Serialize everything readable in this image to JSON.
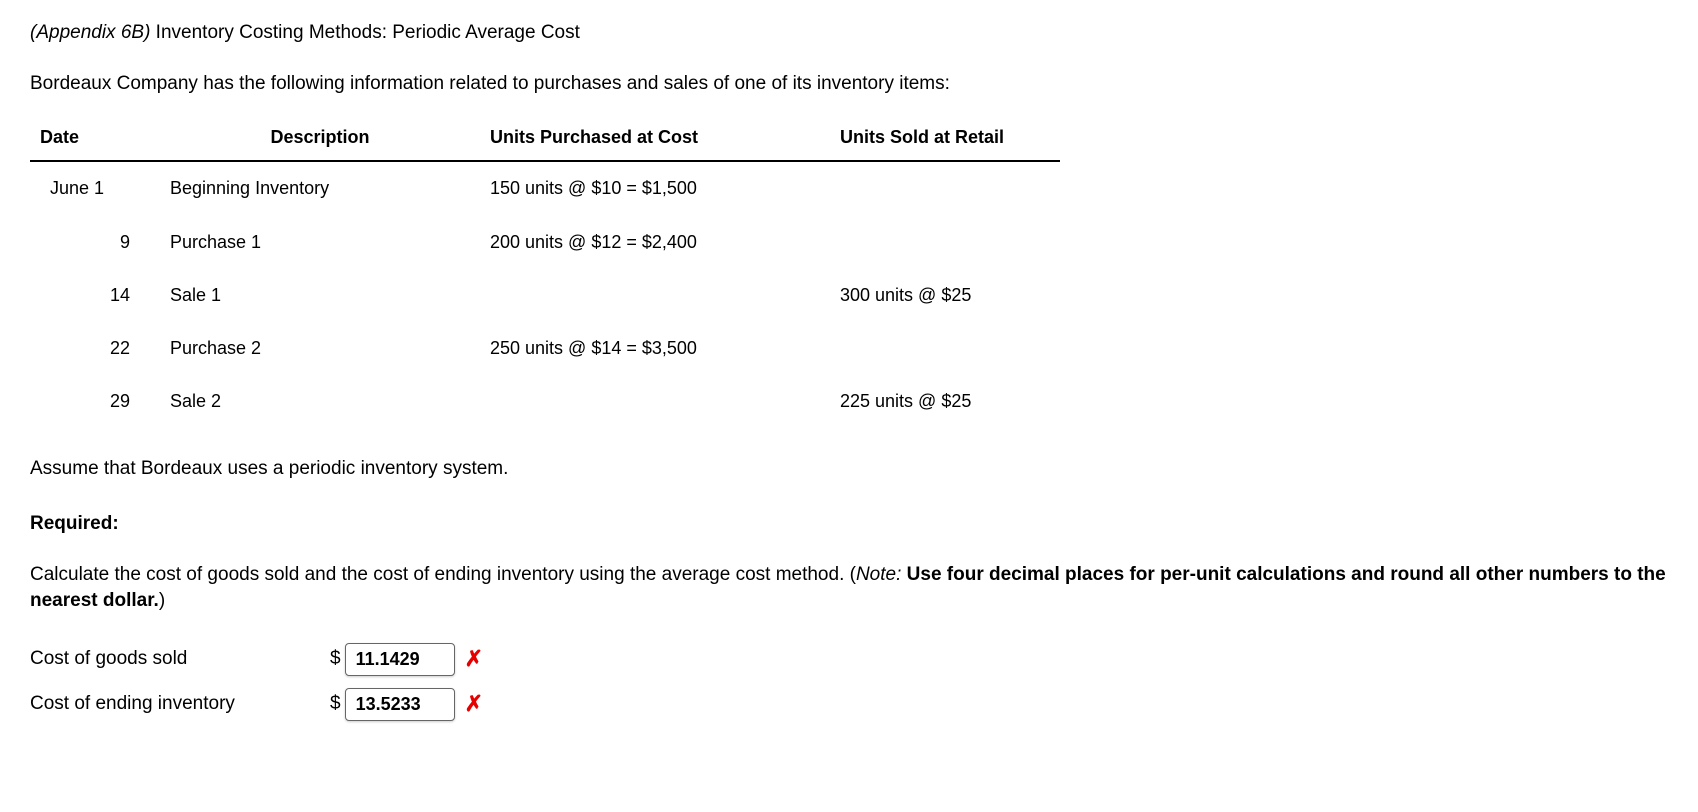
{
  "title_italic": "(Appendix 6B)",
  "title_rest": " Inventory Costing Methods: Periodic Average Cost",
  "intro": "Bordeaux Company has the following information related to purchases and sales of one of its inventory items:",
  "table": {
    "headers": {
      "date": "Date",
      "description": "Description",
      "purchased": "Units Purchased at Cost",
      "sold": "Units Sold at Retail"
    },
    "rows": [
      {
        "date": "June 1",
        "desc": "Beginning Inventory",
        "purchased": "150 units @ $10 = $1,500",
        "sold": ""
      },
      {
        "date": "9",
        "desc": "Purchase 1",
        "purchased": "200 units @ $12 = $2,400",
        "sold": ""
      },
      {
        "date": "14",
        "desc": "Sale 1",
        "purchased": "",
        "sold": "300 units @ $25"
      },
      {
        "date": "22",
        "desc": "Purchase 2",
        "purchased": "250 units @ $14 = $3,500",
        "sold": ""
      },
      {
        "date": "29",
        "desc": "Sale 2",
        "purchased": "",
        "sold": "225 units @ $25"
      }
    ]
  },
  "assume": "Assume that Bordeaux uses a periodic inventory system.",
  "required_label": "Required:",
  "instructions_main": "Calculate the cost of goods sold and the cost of ending inventory using the average cost method. (",
  "instructions_note_label": "Note:",
  "instructions_bold": " Use four decimal places for per-unit calculations and round all other numbers to the nearest dollar.",
  "instructions_close": ")",
  "answers": {
    "cogs": {
      "label": "Cost of goods sold",
      "currency": "$",
      "value": "11.1429",
      "mark": "✗"
    },
    "ending": {
      "label": "Cost of ending inventory",
      "currency": "$",
      "value": "13.5233",
      "mark": "✗"
    }
  }
}
